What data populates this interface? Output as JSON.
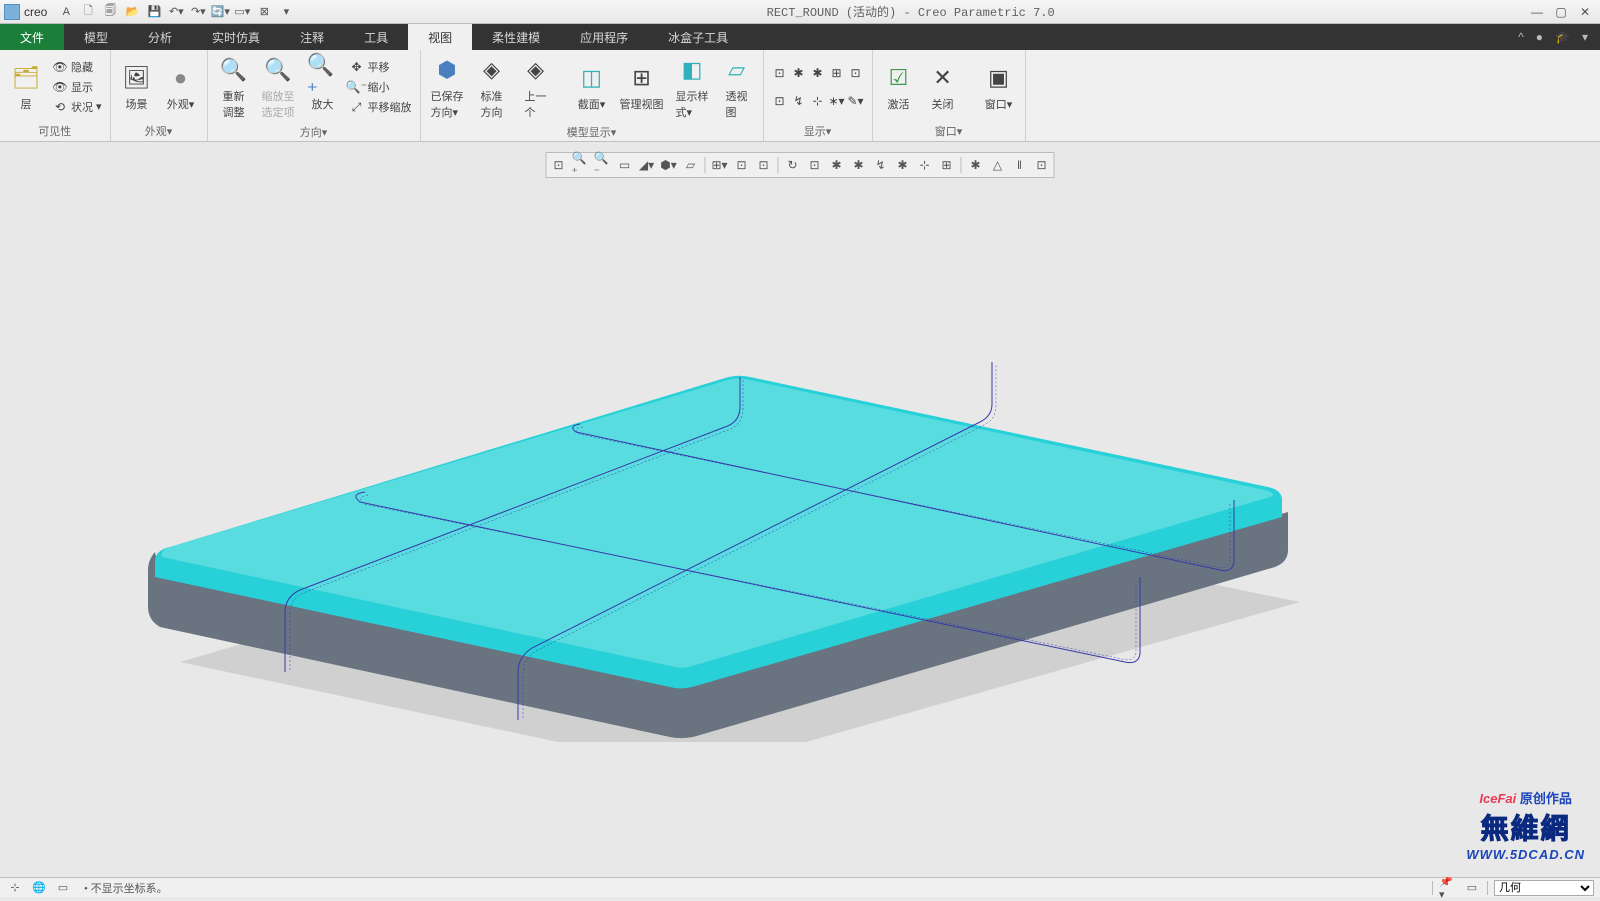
{
  "app": {
    "name": "creo",
    "title": "RECT_ROUND (活动的) - Creo Parametric 7.0"
  },
  "menu": {
    "file": "文件",
    "tabs": [
      "模型",
      "分析",
      "实时仿真",
      "注释",
      "工具",
      "视图",
      "柔性建模",
      "应用程序",
      "冰盒子工具"
    ],
    "active": "视图"
  },
  "ribbon": {
    "groups": {
      "visibility": {
        "label": "可见性",
        "layer": "层",
        "hide": "隐藏",
        "show": "显示",
        "status": "状况"
      },
      "appearance": {
        "label": "外观",
        "scene": "场景",
        "appearance": "外观"
      },
      "orientation": {
        "label": "方向",
        "refit": "重新\n调整",
        "zoom_to": "缩放至\n选定项",
        "zoom_in": "放大",
        "pan": "平移",
        "zoom_out": "缩小",
        "pan_zoom": "平移缩放"
      },
      "model_display": {
        "label": "模型显示",
        "saved": "已保存\n方向",
        "standard": "标准\n方向",
        "previous": "上一\n个",
        "section": "截面",
        "manage": "管理视图",
        "style": "显示样\n式",
        "perspective": "透视\n图"
      },
      "show": {
        "label": "显示"
      },
      "window": {
        "label": "窗口",
        "activate": "激活",
        "close": "关闭",
        "window": "窗口"
      }
    }
  },
  "status": {
    "message": "• 不显示坐标系。",
    "dropdown": "几何"
  },
  "watermark": {
    "line1a": "IceFai",
    "line1b": "原创作品",
    "line2": "無維網",
    "line3": "WWW.5DCAD.CN"
  }
}
